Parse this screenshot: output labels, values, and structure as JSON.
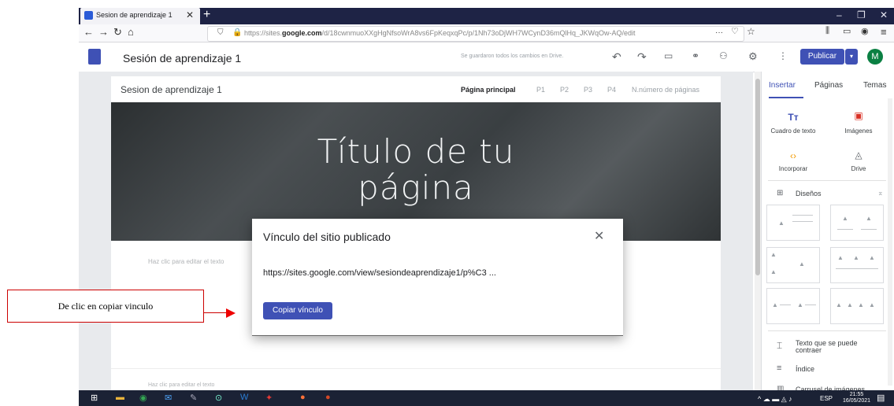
{
  "browser": {
    "tab_title": "Sesion de aprendizaje 1",
    "tab_close": "✕",
    "new_tab": "+",
    "url_prefix": "https://sites.",
    "url_domain": "google.com",
    "url_rest": "/d/18cwnmuoXXgHgNfsoWrA8vs6FpKeqxqPc/p/1Nh73oDjWH7WCynD36mQlHq_JKWqOw-AQ/edit",
    "url_more": "···"
  },
  "toolbar": {
    "doc_title": "Sesión de aprendizaje 1",
    "save_status": "Se guardaron todos los cambios en Drive.",
    "publish_label": "Publicar",
    "avatar_letter": "M"
  },
  "page": {
    "site_name": "Sesion de aprendizaje 1",
    "nav": [
      "Página principal",
      "P1",
      "P2",
      "P3",
      "P4",
      "N.número de páginas"
    ],
    "banner_title_line1": "Título de tu",
    "banner_title_line2": "página",
    "hint_text": "Haz clic para editar el texto"
  },
  "dialog": {
    "title": "Vínculo del sitio publicado",
    "url": "https://sites.google.com/view/sesiondeaprendizaje1/p%C3  ...",
    "copy_button": "Copiar vínculo",
    "close": "✕"
  },
  "annotation": {
    "text": "De clic en copiar vinculo"
  },
  "panel": {
    "tabs": [
      "Insertar",
      "Páginas",
      "Temas"
    ],
    "items": [
      "Cuadro de texto",
      "Imágenes",
      "Incorporar",
      "Drive"
    ],
    "layouts_label": "Diseños",
    "list": [
      "Texto que se puede contraer",
      "Índice",
      "Carrusel de imágenes"
    ]
  },
  "taskbar": {
    "lang": "ESP",
    "time": "21:55",
    "date": "16/05/2021"
  },
  "colors": {
    "accent": "#3f51b5",
    "annotation_red": "#cc0000",
    "avatar": "#0b8043"
  }
}
